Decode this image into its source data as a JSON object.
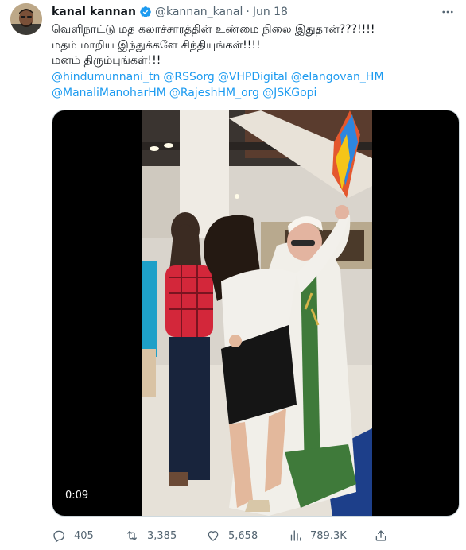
{
  "author": {
    "display_name": "kanal kannan",
    "handle": "@kannan_kanal",
    "separator": "·",
    "date": "Jun 18",
    "verified_icon": "verified-badge-icon",
    "more_icon": "more-horizontal-icon"
  },
  "tweet": {
    "lines": [
      "வெளிநாட்டு மத கலாச்சாரத்தின் உண்மை நிலை இதுதான்???!!!!",
      "மதம் மாறிய இந்துக்களே சிந்தியுங்கள்!!!!",
      "மனம் திரும்புங்கள்!!!"
    ],
    "mentions_row1": [
      "@hindumunnani_tn",
      "@RSSorg",
      "@VHPDigital",
      "@elangovan_HM"
    ],
    "mentions_row2": [
      "@ManaliManoharHM",
      "@RajeshHM_org",
      "@JSKGopi"
    ]
  },
  "media": {
    "type": "video",
    "timestamp": "0:09"
  },
  "actions": {
    "reply_count": "405",
    "retweet_count": "3,385",
    "like_count": "5,658",
    "views_count": "789.3K"
  },
  "colors": {
    "accent": "#1d9bf0",
    "text": "#0f1419",
    "muted": "#536471"
  }
}
